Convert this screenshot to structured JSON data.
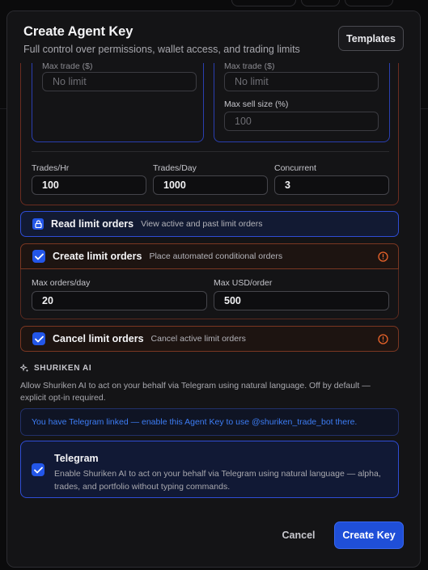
{
  "header": {
    "title": "Create Agent Key",
    "subtitle": "Full control over permissions, wallet access, and trading limits",
    "templates_label": "Templates"
  },
  "trade_limits": {
    "buy": {
      "max_trade_label": "Max trade ($)",
      "max_trade_placeholder": "No limit"
    },
    "sell": {
      "max_trade_label": "Max trade ($)",
      "max_trade_placeholder": "No limit",
      "max_sell_size_label": "Max sell size (%)",
      "max_sell_size_placeholder": "100"
    },
    "trades_hr_label": "Trades/Hr",
    "trades_hr_value": "100",
    "trades_day_label": "Trades/Day",
    "trades_day_value": "1000",
    "concurrent_label": "Concurrent",
    "concurrent_value": "3"
  },
  "permissions": {
    "read_limit_orders": {
      "title": "Read limit orders",
      "description": "View active and past limit orders",
      "icon": "lock-icon"
    },
    "create_limit_orders": {
      "title": "Create limit orders",
      "description": "Place automated conditional orders",
      "checked": true,
      "max_orders_day_label": "Max orders/day",
      "max_orders_day_value": "20",
      "max_usd_order_label": "Max USD/order",
      "max_usd_order_value": "500"
    },
    "cancel_limit_orders": {
      "title": "Cancel limit orders",
      "description": "Cancel active limit orders",
      "checked": true
    }
  },
  "shuriken_ai": {
    "heading": "SHURIKEN AI",
    "description": "Allow Shuriken AI to act on your behalf via Telegram using natural language. Off by default — explicit opt-in required.",
    "linked_notice": "You have Telegram linked — enable this Agent Key to use @shuriken_trade_bot there.",
    "telegram_title": "Telegram",
    "telegram_description": "Enable Shuriken AI to act on your behalf via Telegram using natural language — alpha, trades, and portfolio without typing commands.",
    "telegram_checked": true
  },
  "footer": {
    "cancel_label": "Cancel",
    "create_label": "Create Key"
  },
  "colors": {
    "accent": "#2356e8",
    "warning": "#e8632a",
    "link": "#3d7df5"
  }
}
